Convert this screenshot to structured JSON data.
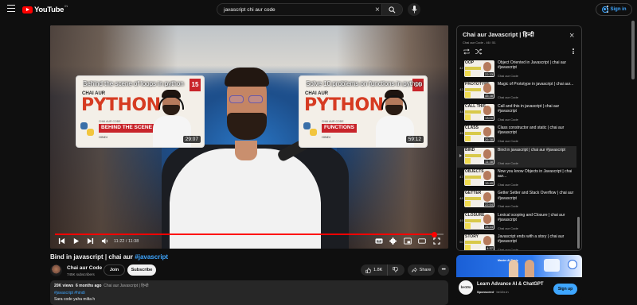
{
  "header": {
    "logo_text": "YouTube",
    "country": "IN",
    "search_query": "javascript chi aur code",
    "signin_label": "Sign in"
  },
  "player": {
    "endscreen": [
      {
        "title": "Behind the scene of loops in python",
        "brand": "CHAI AUR",
        "word": "PYTHON",
        "bar": "BEHIND THE SCENE OF LOOP",
        "bar_label": "CHAI AUR CODE",
        "lang": "HINDI",
        "episode": "15",
        "duration": "29:07"
      },
      {
        "title": "Solve 10 problems on functions in python",
        "brand": "CHAI AUR",
        "word": "PYTHON",
        "bar": "FUNCTIONS",
        "bar_label": "CHAI AUR CODE",
        "lang": "HINDI",
        "episode": "16",
        "duration": "59:12"
      }
    ],
    "time_display": "11:22 / 11:38",
    "progress": 0.977
  },
  "video": {
    "title_main": "Bind in javascript | chai aur ",
    "title_tag": "#javascript",
    "channel": "Chai aur Code",
    "subscribers": "745K subscribers",
    "join_label": "Join",
    "subscribe_label": "Subscribe",
    "likes": "1.8K",
    "share_label": "Share"
  },
  "description": {
    "views": "20K views",
    "age": "6 months ago",
    "topic": "Chai aur Javascript | हिन्दी",
    "hashtags": "#javascript #hindi",
    "line": "Sara code yaha milta h"
  },
  "playlist": {
    "title": "Chai aur Javascript | हिन्दी",
    "subtitle": "Chai aur Code - 46 / 51",
    "items": [
      {
        "index": "42",
        "title": "Object Oriented in Javascript | chai aur #javascript",
        "channel": "Chai aur Code",
        "duration": "22:33",
        "thumb_text": "OOP",
        "active": false
      },
      {
        "index": "43",
        "title": "Magic of Prototype in javascript | chai aur...",
        "channel": "Chai aur Code",
        "duration": "45:38",
        "thumb_text": "PROTOTYPE",
        "active": false
      },
      {
        "index": "44",
        "title": "Call and this in javascript | chai aur #javascript",
        "channel": "Chai aur Code",
        "duration": "13:09",
        "thumb_text": "CALL THIS",
        "active": false
      },
      {
        "index": "45",
        "title": "Class constructor and static | chai aur #javascript",
        "channel": "Chai aur Code",
        "duration": "26:38",
        "thumb_text": "CLASS",
        "active": false
      },
      {
        "index": "",
        "title": "Bind in javascript | chai aur #javascript",
        "channel": "Chai aur Code",
        "duration": "11:38",
        "thumb_text": "BIND",
        "active": true
      },
      {
        "index": "47",
        "title": "Now you know Objects in Javascript | chai aur...",
        "channel": "Chai aur Code",
        "duration": "19:40",
        "thumb_text": "OBJECTS",
        "active": false
      },
      {
        "index": "48",
        "title": "Getter Setter and Stack Overflow | chai aur #javascript",
        "channel": "Chai aur Code",
        "duration": "22:54",
        "thumb_text": "GETTER",
        "active": false
      },
      {
        "index": "49",
        "title": "Lexical scoping and Closure | chai aur #javascript",
        "channel": "Chai aur Code",
        "duration": "28:44",
        "thumb_text": "CLOSURE",
        "active": false
      },
      {
        "index": "50",
        "title": "Javascript ends with a story | chai aur #javascript",
        "channel": "Chai aur Code",
        "duration": "4:37",
        "thumb_text": "STORY",
        "active": false
      }
    ]
  },
  "ad": {
    "banner_text": "Master AI Tools",
    "logo_text": "be10x",
    "title": "Learn Advance AI & ChatGPT",
    "sponsored": "Sponsored",
    "domain": "be10x.in",
    "signup_label": "Sign up"
  },
  "colors": {
    "accent_blue": "#3ea6ff",
    "brand_red": "#ff0000",
    "background": "#0f0f0f"
  }
}
